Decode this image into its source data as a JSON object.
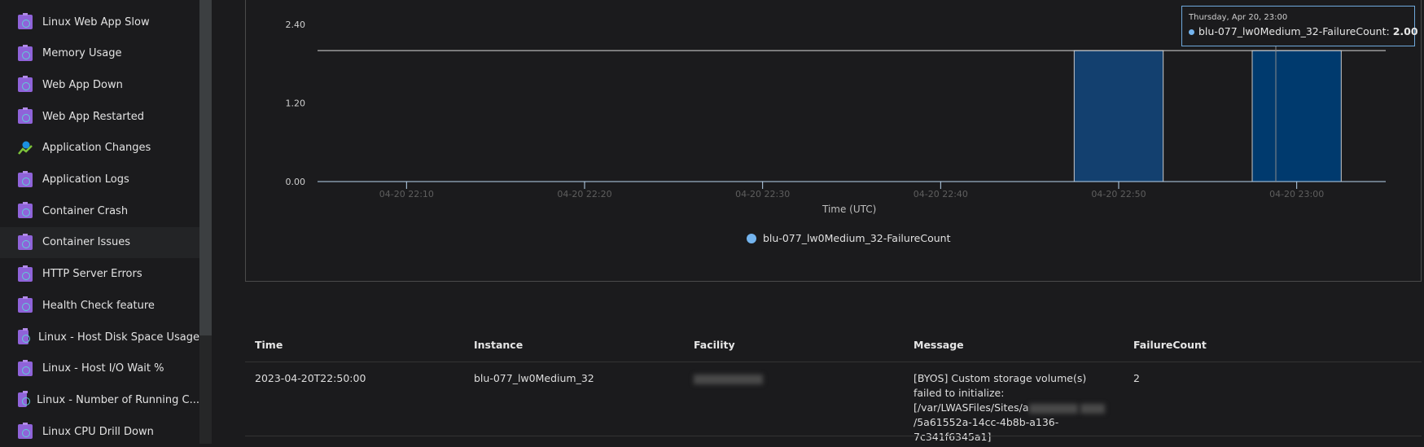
{
  "sidebar": {
    "items": [
      {
        "label": "Linux Web App Slow",
        "icon": "workbook-icon"
      },
      {
        "label": "Memory Usage",
        "icon": "workbook-icon"
      },
      {
        "label": "Web App Down",
        "icon": "workbook-icon"
      },
      {
        "label": "Web App Restarted",
        "icon": "workbook-icon"
      },
      {
        "label": "Application Changes",
        "icon": "change-analysis-icon"
      },
      {
        "label": "Application Logs",
        "icon": "workbook-icon"
      },
      {
        "label": "Container Crash",
        "icon": "workbook-icon"
      },
      {
        "label": "Container Issues",
        "icon": "workbook-icon",
        "selected": true
      },
      {
        "label": "HTTP Server Errors",
        "icon": "workbook-icon"
      },
      {
        "label": "Health Check feature",
        "icon": "workbook-icon"
      },
      {
        "label": "Linux - Host Disk Space Usage",
        "icon": "workbook-icon"
      },
      {
        "label": "Linux - Host I/O Wait %",
        "icon": "workbook-icon"
      },
      {
        "label": "Linux - Number of Running C...",
        "icon": "workbook-icon"
      },
      {
        "label": "Linux CPU Drill Down",
        "icon": "workbook-icon"
      }
    ]
  },
  "chart_data": {
    "type": "bar",
    "xlabel": "Time (UTC)",
    "ylabel": "",
    "xlim": [
      "04-20 22:05",
      "04-20 23:05"
    ],
    "ylim": [
      0,
      2.4
    ],
    "yticks": [
      "0.00",
      "1.20",
      "2.40"
    ],
    "xticks": [
      "04-20 22:10",
      "04-20 22:20",
      "04-20 22:30",
      "04-20 22:40",
      "04-20 22:50",
      "04-20 23:00"
    ],
    "legend_position": "bottom",
    "series": [
      {
        "name": "blu-077_lw0Medium_32-FailureCount",
        "color": "#74b4ee",
        "points": [
          {
            "x": "04-20 22:50",
            "value": 2
          },
          {
            "x": "04-20 23:00",
            "value": 2
          }
        ]
      }
    ],
    "bin_minutes": 5,
    "reference_line": 2.0,
    "bar_colors": [
      "#13406f",
      "#003a6e"
    ],
    "tooltip": {
      "title": "Thursday, Apr 20, 23:00",
      "series": "blu-077_lw0Medium_32-FailureCount:",
      "value": "2.00"
    }
  },
  "table": {
    "columns": [
      "Time",
      "Instance",
      "Facility",
      "Message",
      "FailureCount"
    ],
    "rows": [
      {
        "time": "2023-04-20T22:50:00",
        "instance": "blu-077_lw0Medium_32",
        "facility": "",
        "message_parts": [
          "[BYOS] Custom storage volume(s) failed to initialize: [/var/LWASFiles/Sites/a",
          "/5a61552a-14cc-4b8b-a136-7c341f6345a1]"
        ],
        "failure_count": "2"
      }
    ]
  }
}
